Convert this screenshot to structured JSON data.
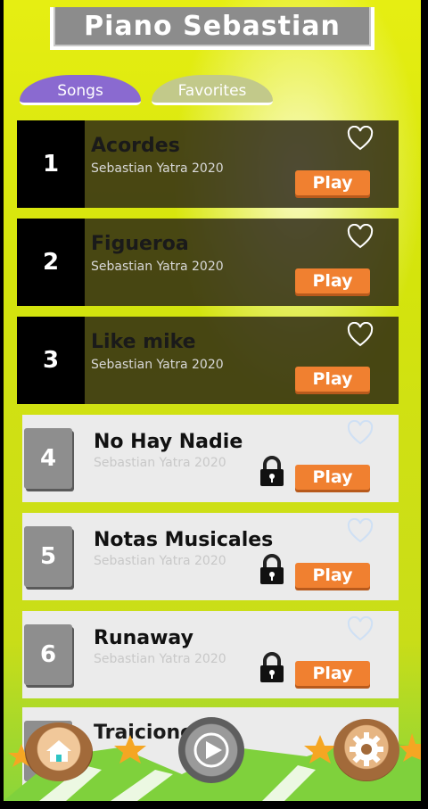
{
  "header": {
    "title": "Piano Sebastian"
  },
  "tabs": [
    {
      "label": "Songs"
    },
    {
      "label": "Favorites"
    }
  ],
  "songs": [
    {
      "number": "1",
      "title": "Acordes",
      "artist": "Sebastian Yatra 2020",
      "play_label": "Play",
      "locked": false
    },
    {
      "number": "2",
      "title": "Figueroa",
      "artist": "Sebastian Yatra 2020",
      "play_label": "Play",
      "locked": false
    },
    {
      "number": "3",
      "title": "Like mike",
      "artist": "Sebastian Yatra 2020",
      "play_label": "Play",
      "locked": false
    },
    {
      "number": "4",
      "title": "No Hay Nadie",
      "artist": "Sebastian Yatra 2020",
      "play_label": "Play",
      "locked": true
    },
    {
      "number": "5",
      "title": "Notas Musicales",
      "artist": "Sebastian Yatra 2020",
      "play_label": "Play",
      "locked": true
    },
    {
      "number": "6",
      "title": "Runaway",
      "artist": "Sebastian Yatra 2020",
      "play_label": "Play",
      "locked": true
    },
    {
      "number": "",
      "title": "Traicione",
      "artist": "",
      "play_label": "",
      "locked": true
    }
  ],
  "bottom_nav": {
    "home_icon": "home-icon",
    "play_icon": "play-icon",
    "settings_icon": "gear-icon"
  },
  "colors": {
    "accent": "#f08030",
    "tab_active": "#8a6ad0",
    "tab_inactive": "#c2c98a"
  }
}
